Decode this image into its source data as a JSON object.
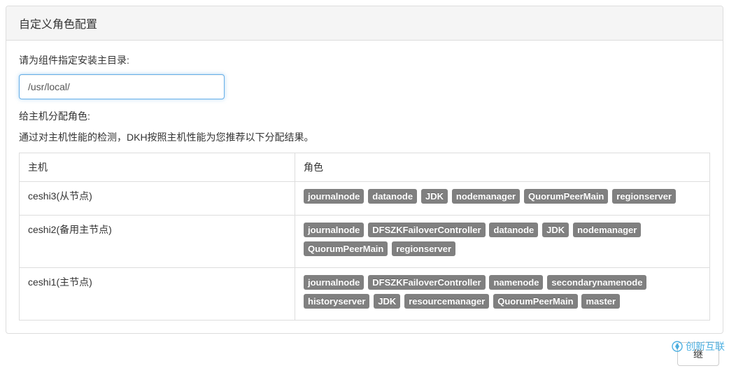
{
  "panel": {
    "title": "自定义角色配置",
    "install_dir_label": "请为组件指定安装主目录:",
    "install_dir_value": "/usr/local/",
    "assign_label": "给主机分配角色:",
    "hint": "通过对主机性能的检测，DKH按照主机性能为您推荐以下分配结果。"
  },
  "table": {
    "headers": {
      "host": "主机",
      "role": "角色"
    },
    "rows": [
      {
        "host": "ceshi3(从节点)",
        "roles": [
          "journalnode",
          "datanode",
          "JDK",
          "nodemanager",
          "QuorumPeerMain",
          "regionserver"
        ]
      },
      {
        "host": "ceshi2(备用主节点)",
        "roles": [
          "journalnode",
          "DFSZKFailoverController",
          "datanode",
          "JDK",
          "nodemanager",
          "QuorumPeerMain",
          "regionserver"
        ]
      },
      {
        "host": "ceshi1(主节点)",
        "roles": [
          "journalnode",
          "DFSZKFailoverController",
          "namenode",
          "secondarynamenode",
          "historyserver",
          "JDK",
          "resourcemanager",
          "QuorumPeerMain",
          "master"
        ]
      }
    ]
  },
  "footer": {
    "button": "继"
  },
  "watermark": "创新互联"
}
